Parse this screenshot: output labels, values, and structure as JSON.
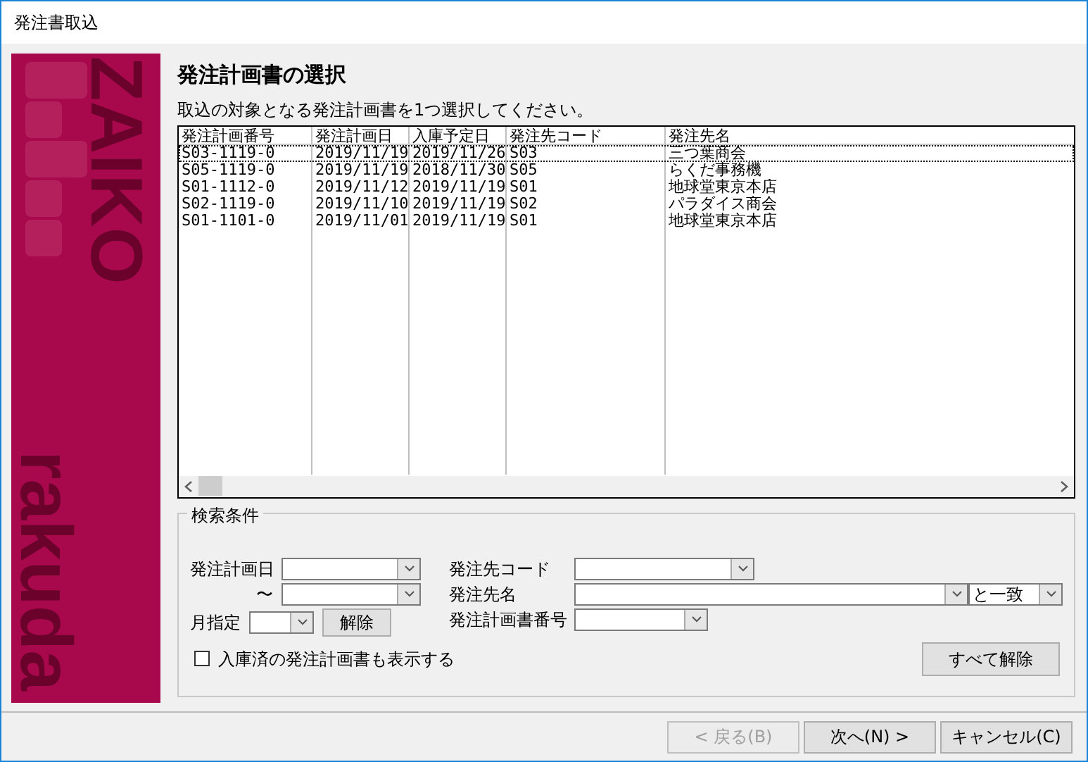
{
  "window": {
    "title": "発注書取込"
  },
  "sidebar": {
    "logo_top": "ZAIKO",
    "logo_bottom": "rakuda"
  },
  "heading": "発注計画書の選択",
  "instruction": "取込の対象となる発注計画書を1つ選択してください。",
  "table": {
    "columns": [
      "発注計画番号",
      "発注計画日",
      "入庫予定日",
      "発注先コード",
      "発注先名"
    ],
    "rows": [
      {
        "cells": [
          "S03-1119-0",
          "2019/11/19",
          "2019/11/26",
          "S03",
          "三つ葉商会"
        ],
        "focused": true
      },
      {
        "cells": [
          "S05-1119-0",
          "2019/11/19",
          "2018/11/30",
          "S05",
          "らくだ事務機"
        ],
        "focused": false
      },
      {
        "cells": [
          "S01-1112-0",
          "2019/11/12",
          "2019/11/19",
          "S01",
          "地球堂東京本店"
        ],
        "focused": false
      },
      {
        "cells": [
          "S02-1119-0",
          "2019/11/10",
          "2019/11/19",
          "S02",
          "パラダイス商会"
        ],
        "focused": false
      },
      {
        "cells": [
          "S01-1101-0",
          "2019/11/01",
          "2019/11/19",
          "S01",
          "地球堂東京本店"
        ],
        "focused": false
      }
    ]
  },
  "search": {
    "title": "検索条件",
    "date_label": "発注計画日",
    "range_label": "〜",
    "month_label": "月指定",
    "clear_month_button": "解除",
    "code_label": "発注先コード",
    "name_label": "発注先名",
    "match_mode": "と一致",
    "number_label": "発注計画書番号",
    "show_received": {
      "label": "入庫済の発注計画書も表示する",
      "checked": false
    },
    "clear_all_button": "すべて解除"
  },
  "buttons": [
    {
      "label": "< 戻る(B)",
      "disabled": true
    },
    {
      "label": "次へ(N) >",
      "disabled": false
    },
    {
      "label": "キャンセル(C)",
      "disabled": false
    }
  ]
}
